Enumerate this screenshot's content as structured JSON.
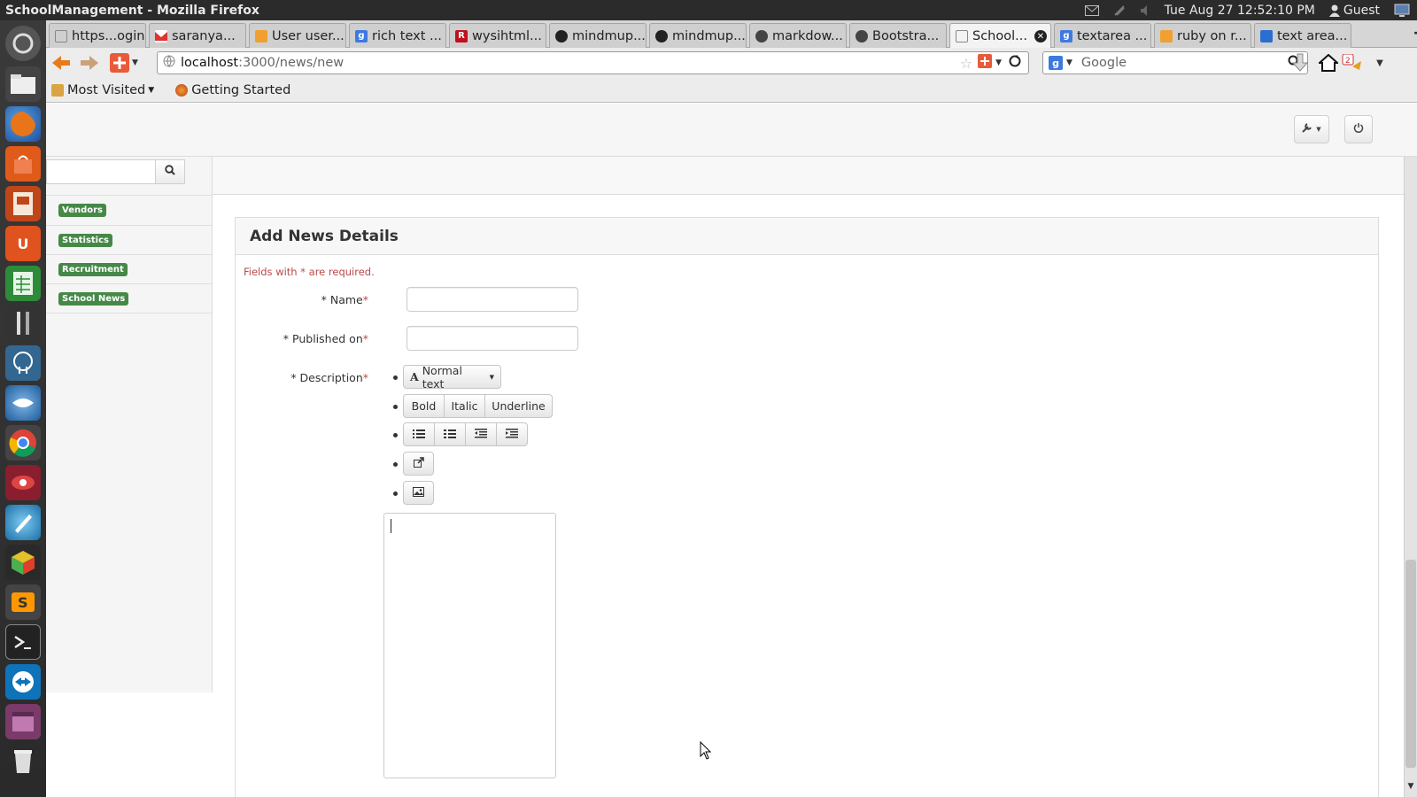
{
  "window": {
    "title": "SchoolManagement - Mozilla Firefox",
    "clock": "Tue Aug 27 12:52:10 PM",
    "user": "Guest"
  },
  "launcher": {
    "icons": [
      "dash-icon",
      "files-icon",
      "firefox-icon",
      "software-center-icon",
      "impress-icon",
      "ubuntu-one-icon",
      "calc-icon",
      "tools-icon",
      "postgres-icon",
      "thunderbird-icon",
      "chrome-icon",
      "eye-app-icon",
      "inkscape-icon",
      "cube-app-icon",
      "sublime-icon",
      "terminal-icon",
      "teamviewer-icon",
      "workspace-icon",
      "trash-icon"
    ]
  },
  "tabs": [
    {
      "label": "https...ogin",
      "icon": "blank-page-icon"
    },
    {
      "label": "saranya...",
      "icon": "gmail-icon"
    },
    {
      "label": "User user...",
      "icon": "stackoverflow-icon"
    },
    {
      "label": "rich text ...",
      "icon": "google-icon"
    },
    {
      "label": "wysihtml...",
      "icon": "r-icon"
    },
    {
      "label": "mindmup...",
      "icon": "github-icon"
    },
    {
      "label": "mindmup...",
      "icon": "github-icon"
    },
    {
      "label": "markdow...",
      "icon": "octocat-icon"
    },
    {
      "label": "Bootstra...",
      "icon": "octocat-icon"
    },
    {
      "label": "School...",
      "icon": "blank-page-icon",
      "active": true
    },
    {
      "label": "textarea ...",
      "icon": "google-icon"
    },
    {
      "label": "ruby on r...",
      "icon": "stackoverflow-icon"
    },
    {
      "label": "text area...",
      "icon": "blog-icon"
    }
  ],
  "navbar": {
    "url_host": "localhost",
    "url_path": ":3000/news/new",
    "search_placeholder": "Google"
  },
  "bookmarks": {
    "most_visited": "Most Visited",
    "getting_started": "Getting Started"
  },
  "sidebar": {
    "search_value": "",
    "items": [
      {
        "label": "Vendors"
      },
      {
        "label": "Statistics"
      },
      {
        "label": "Recruitment"
      },
      {
        "label": "School News"
      }
    ]
  },
  "form": {
    "heading": "Add News Details",
    "required_note": "Fields with * are required.",
    "name_label": "* Name",
    "published_label": "* Published on",
    "description_label": "* Description",
    "required_star": "*",
    "name_value": "",
    "published_value": "",
    "editor": {
      "style_dropdown": "Normal text",
      "bold": "Bold",
      "italic": "Italic",
      "underline": "Underline",
      "content": ""
    }
  },
  "colors": {
    "label_green": "#468847",
    "required_red": "#b94a48",
    "system_bar": "#2b2b2b"
  }
}
